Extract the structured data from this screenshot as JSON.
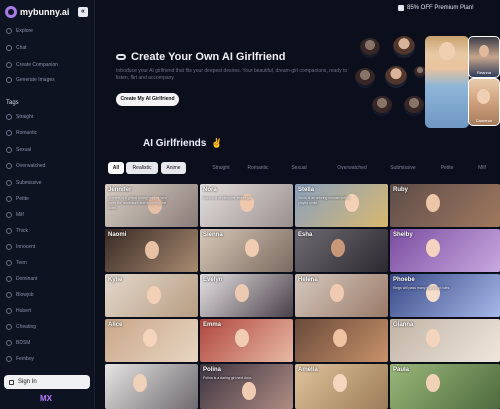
{
  "app": {
    "logo_text": "mybunny.ai",
    "collapse_glyph": "«"
  },
  "sidebar": {
    "items": [
      {
        "label": "Explore",
        "icon": "compass-icon"
      },
      {
        "label": "Chat",
        "icon": "chat-icon"
      },
      {
        "label": "Create Companion",
        "icon": "plus-icon"
      },
      {
        "label": "Generate Images",
        "icon": "image-icon"
      }
    ],
    "tags_heading": "Tags",
    "tags": [
      "Straight",
      "Romantic",
      "Sexual",
      "Overwatched",
      "Submissive",
      "Petite",
      "Milf",
      "Thick",
      "Innocent",
      "Teen",
      "Dominant",
      "Blowjob",
      "Hubert",
      "Cheating",
      "BDSM",
      "Femboy"
    ],
    "sign_in": "Sign In",
    "badge": "MX"
  },
  "promo": {
    "text": "85% OFF Premium Plan!",
    "icon": "gift-icon"
  },
  "hero": {
    "title": "Create Your Own AI Girlfriend",
    "description": "Introduce your AI girlfriend that fits your deepest desires. Your beautiful, dream-girl companions, ready to listen, flirt and accompany.",
    "cta": "Create My AI Girlfriend",
    "card_captions": [
      "Reanna",
      "Cameron"
    ]
  },
  "section": {
    "title": "AI Girlfriends",
    "icon": "hand-icon"
  },
  "filters": {
    "segments": [
      "All",
      "Realistic",
      "Anime"
    ],
    "active": "All",
    "tags": [
      "Straight",
      "Romantic",
      "Sexual",
      "Overwatched",
      "Submissive",
      "Petite",
      "Milf"
    ]
  },
  "cards": [
    {
      "name": "Jennifer",
      "desc": "Jennifer is a global bunny hopper who loves the adventure and exploring the world."
    },
    {
      "name": "Nora",
      "desc": "Nora is a wholesome sweet girl."
    },
    {
      "name": "Stella",
      "desc": "Stella is an alluring woman with a playful smile."
    },
    {
      "name": "Ruby",
      "desc": ""
    },
    {
      "name": "Naomi",
      "desc": ""
    },
    {
      "name": "Sienna",
      "desc": ""
    },
    {
      "name": "Esha",
      "desc": ""
    },
    {
      "name": "Shelby",
      "desc": ""
    },
    {
      "name": "Kylie",
      "desc": ""
    },
    {
      "name": "Evelyn",
      "desc": ""
    },
    {
      "name": "Helena",
      "desc": ""
    },
    {
      "name": "Phoebe",
      "desc": "Kings will pass many trials and rules."
    },
    {
      "name": "Alice",
      "desc": ""
    },
    {
      "name": "Emma",
      "desc": ""
    },
    {
      "name": "",
      "desc": ""
    },
    {
      "name": "Gianna",
      "desc": ""
    },
    {
      "name": "",
      "desc": ""
    },
    {
      "name": "Polina",
      "desc": "Polina is a daring girl next door."
    },
    {
      "name": "Amelia",
      "desc": ""
    },
    {
      "name": "Paula",
      "desc": ""
    }
  ]
}
